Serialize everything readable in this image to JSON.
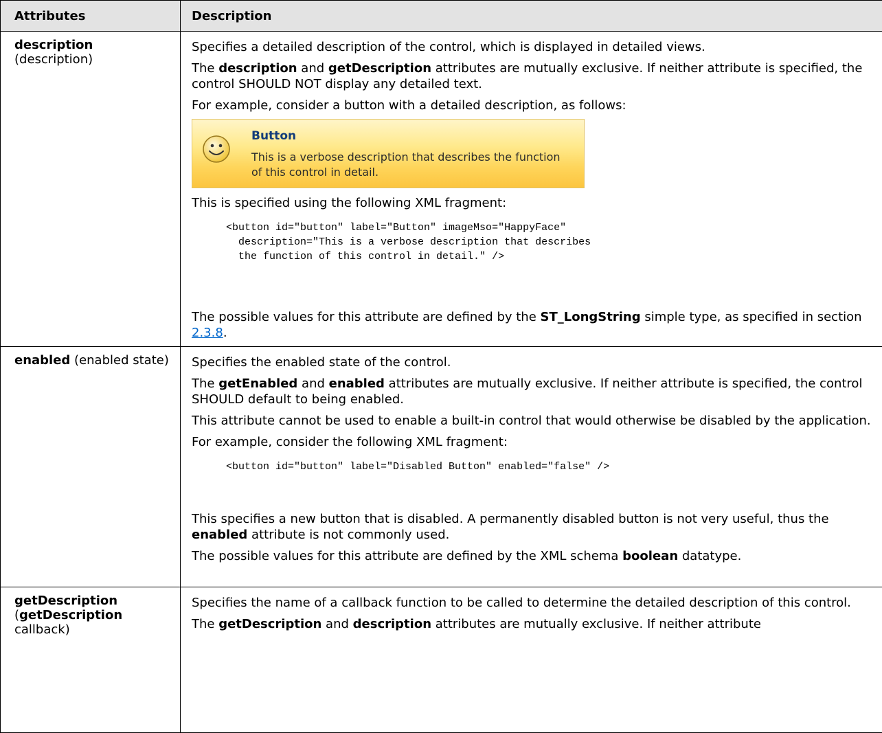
{
  "header": {
    "col1": "Attributes",
    "col2": "Description"
  },
  "rows": [
    {
      "attr_bold": "description",
      "attr_rest": "(description)",
      "p1": "Specifies a detailed description of the control, which is displayed in detailed views.",
      "p2_a": "The ",
      "p2_b": "description",
      "p2_c": " and ",
      "p2_d": "getDescription",
      "p2_e": " attributes are mutually exclusive. If neither attribute is specified, the control SHOULD NOT display any detailed text.",
      "p3": "For example, consider a button with a detailed description, as follows:",
      "tooltip": {
        "icon": "happy-face-icon",
        "title": "Button",
        "text": "This is a verbose description that describes the function of this control in detail."
      },
      "p4": "This is specified using the following XML fragment:",
      "code": "<button id=\"button\" label=\"Button\" imageMso=\"HappyFace\"\n  description=\"This is a verbose description that describes\n  the function of this control in detail.\" />",
      "p5_a": "The possible values for this attribute are defined by the ",
      "p5_b": "ST_LongString",
      "p5_c": " simple type, as specified in section ",
      "p5_link": "2.3.8",
      "p5_d": "."
    },
    {
      "attr_bold": "enabled",
      "attr_rest": " (enabled state)",
      "p1": "Specifies the enabled state of the control.",
      "p2_a": "The ",
      "p2_b": "getEnabled",
      "p2_c": " and ",
      "p2_d": "enabled",
      "p2_e": " attributes are mutually exclusive. If neither attribute is specified, the control SHOULD default to being enabled.",
      "p3": "This attribute cannot be used to enable a built-in control that would otherwise be disabled by the application.",
      "p4": "For example, consider the following XML fragment:",
      "code": "<button id=\"button\" label=\"Disabled Button\" enabled=\"false\" />",
      "p5_a": "This specifies a new button that is disabled. A permanently disabled button is not very useful, thus the ",
      "p5_b": "enabled",
      "p5_c": " attribute is not commonly used.",
      "p6_a": "The possible values for this attribute are defined by the XML schema ",
      "p6_b": "boolean",
      "p6_c": " datatype."
    },
    {
      "attr_bold": "getDescription",
      "attr_open": "(",
      "attr_bold2": "getDescription",
      "attr_rest": "callback)",
      "p1": "Specifies the name of a callback function to be called to determine the detailed description of this control.",
      "p2_a": "The ",
      "p2_b": "getDescription",
      "p2_c": " and ",
      "p2_d": "description",
      "p2_e": " attributes are mutually exclusive. If neither attribute"
    }
  ]
}
